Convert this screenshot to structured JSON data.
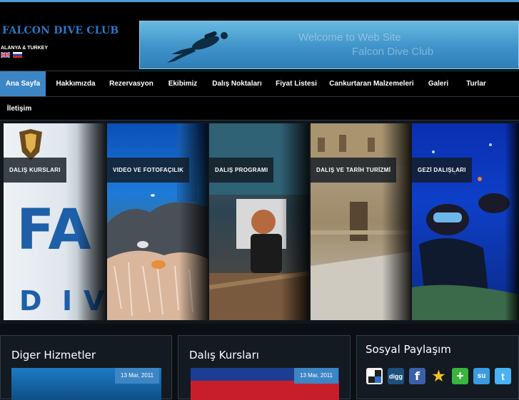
{
  "header": {
    "logo_text": "FALCON DIVE CLUB",
    "location": "ALANYA & TURKEY",
    "banner_line1": "Welcome to Web Site",
    "banner_line2": "Falcon Dive Club"
  },
  "nav": {
    "items": [
      "Ana Sayfa",
      "Hakkımızda",
      "Rezervasyon",
      "Ekibimiz",
      "Dalış Noktaları",
      "Fiyat Listesi",
      "Cankurtaran Malzemeleri",
      "Galeri",
      "Turlar"
    ],
    "second_row": [
      "İletişim"
    ],
    "active": "Ana Sayfa"
  },
  "slider": {
    "panels": [
      "DALIŞ KURSLARI",
      "VIDEO VE FOTOFAÇILIK",
      "DALIŞ PROGRAMI",
      "DALIŞ VE TARİH TURİZMİ",
      "GEZİ DALIŞLARI"
    ]
  },
  "boxes": [
    {
      "title": "Diger Hizmetler",
      "date": "13 Mar, 2011"
    },
    {
      "title": "Dalış Kursları",
      "date": "13 Mar, 2011"
    },
    {
      "title": "Sosyal Paylaşım"
    }
  ],
  "social_icons": [
    "delicious-icon",
    "digg-icon",
    "facebook-icon",
    "favorites-icon",
    "add-icon",
    "stumbleupon-icon",
    "twitter-icon"
  ],
  "social_labels": {
    "digg": "digg",
    "stumble": "su"
  },
  "colors": {
    "accent": "#3d86c6",
    "logo": "#2a78c8",
    "background": "#0b0f14"
  }
}
